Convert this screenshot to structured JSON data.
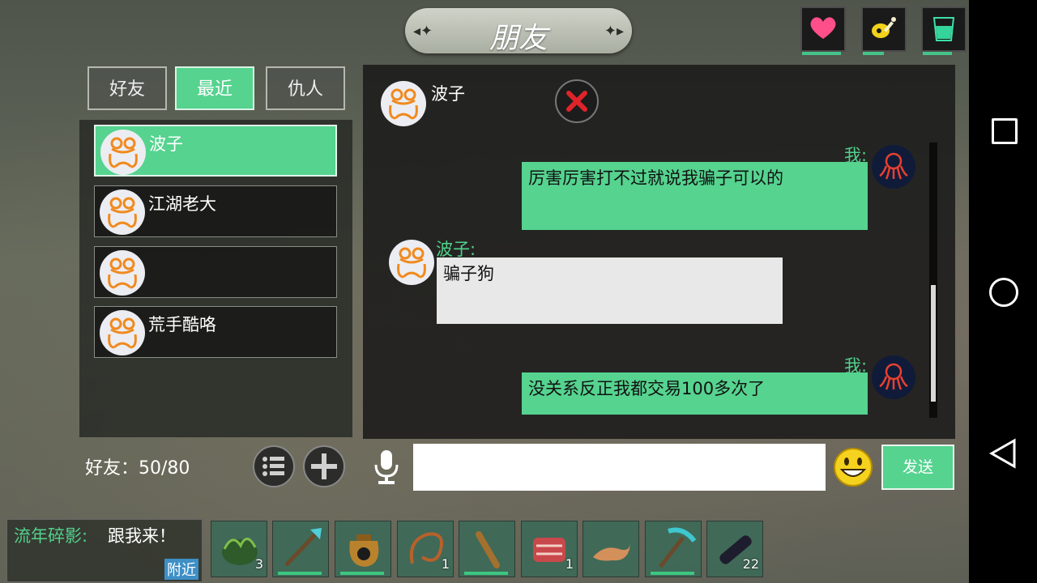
{
  "header": {
    "title": "朋友"
  },
  "tabs": [
    {
      "label": "好友",
      "active": false
    },
    {
      "label": "最近",
      "active": true
    },
    {
      "label": "仇人",
      "active": false
    }
  ],
  "friends": [
    {
      "name": "波子",
      "selected": true
    },
    {
      "name": "江湖老大",
      "selected": false
    },
    {
      "name": "",
      "selected": false
    },
    {
      "name": "荒手酷咯",
      "selected": false
    }
  ],
  "friends_count": {
    "label": "好友：50/80"
  },
  "chat": {
    "partner_name": "波子",
    "messages": [
      {
        "sender": "我:",
        "text": "厉害厉害打不过就说我骗子可以的",
        "from_me": true
      },
      {
        "sender": "波子:",
        "text": "骗子狗",
        "from_me": false
      },
      {
        "sender": "我:",
        "text": "没关系反正我都交易100多次了",
        "from_me": true
      }
    ]
  },
  "input": {
    "placeholder": "",
    "send_label": "发送"
  },
  "chat_log": {
    "sender": "流年碎影",
    "separator": ":",
    "message": "跟我来！",
    "channel": "附近"
  },
  "hotbar": [
    {
      "icon": "herb-bundle-icon",
      "count": "3"
    },
    {
      "icon": "crystal-spear-icon",
      "count": ""
    },
    {
      "icon": "leather-pouch-icon",
      "count": ""
    },
    {
      "icon": "rope-icon",
      "count": "1"
    },
    {
      "icon": "wooden-club-icon",
      "count": ""
    },
    {
      "icon": "raw-meat-icon",
      "count": "1"
    },
    {
      "icon": "leather-scrap-icon",
      "count": ""
    },
    {
      "icon": "pickaxe-icon",
      "count": ""
    },
    {
      "icon": "dark-log-icon",
      "count": "22"
    }
  ],
  "colors": {
    "accent": "#55d38f",
    "accent_text": "#52d18c",
    "panel": "#1e1e1d"
  }
}
